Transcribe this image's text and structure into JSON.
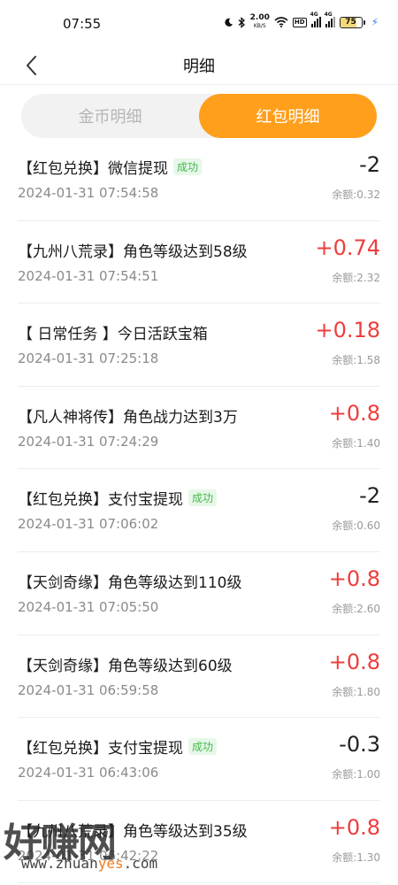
{
  "status_bar": {
    "time": "07:55",
    "net_speed": "2.00",
    "net_unit": "KB/S",
    "hd_label": "HD",
    "signal_label_1": "4G",
    "signal_label_2": "4G",
    "battery_level": "75"
  },
  "header": {
    "title": "明细"
  },
  "tabs": [
    {
      "label": "金币明细",
      "active": false
    },
    {
      "label": "红包明细",
      "active": true
    }
  ],
  "records": [
    {
      "title": "【红包兑换】微信提现",
      "badge": "成功",
      "time": "2024-01-31 07:54:58",
      "amount": "-2",
      "balance": "余额:0.32"
    },
    {
      "title": "【九州八荒录】角色等级达到58级",
      "badge": "",
      "time": "2024-01-31 07:54:51",
      "amount": "+0.74",
      "balance": "余额:2.32"
    },
    {
      "title": "【 日常任务 】今日活跃宝箱",
      "badge": "",
      "time": "2024-01-31 07:25:18",
      "amount": "+0.18",
      "balance": "余额:1.58"
    },
    {
      "title": "【凡人神将传】角色战力达到3万",
      "badge": "",
      "time": "2024-01-31 07:24:29",
      "amount": "+0.8",
      "balance": "余额:1.40"
    },
    {
      "title": "【红包兑换】支付宝提现",
      "badge": "成功",
      "time": "2024-01-31 07:06:02",
      "amount": "-2",
      "balance": "余额:0.60"
    },
    {
      "title": "【天剑奇缘】角色等级达到110级",
      "badge": "",
      "time": "2024-01-31 07:05:50",
      "amount": "+0.8",
      "balance": "余额:2.60"
    },
    {
      "title": "【天剑奇缘】角色等级达到60级",
      "badge": "",
      "time": "2024-01-31 06:59:58",
      "amount": "+0.8",
      "balance": "余额:1.80"
    },
    {
      "title": "【红包兑换】支付宝提现",
      "badge": "成功",
      "time": "2024-01-31 06:43:06",
      "amount": "-0.3",
      "balance": "余额:1.00"
    },
    {
      "title": "【九州八荒录】角色等级达到35级",
      "badge": "",
      "time": "2024-01-31 06:42:22",
      "amount": "+0.8",
      "balance": "余额:1.30"
    }
  ],
  "colors": {
    "accent": "#ff9f1c",
    "positive": "#ee3d3d",
    "negative": "#222222",
    "success_badge": "#47b84f"
  },
  "watermark": {
    "brand": "好赚网",
    "url_prefix": "www.zhuan",
    "url_highlight": "yes",
    "url_suffix": ".com"
  }
}
